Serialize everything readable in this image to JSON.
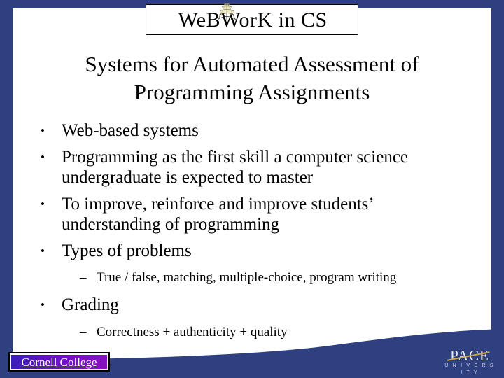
{
  "slide": {
    "header_logo": {
      "text": "WeBWorK in CS",
      "icon": "spider-web-icon"
    },
    "title": "Systems for Automated Assessment of Programming Assignments",
    "title_line1": "Systems for Automated Assessment of",
    "title_line2": "Programming Assignments",
    "bullets": [
      {
        "level": 1,
        "marker": "•",
        "text": "Web-based systems"
      },
      {
        "level": 1,
        "marker": "•",
        "text": "Programming as the first skill a computer science undergraduate is expected to master"
      },
      {
        "level": 1,
        "marker": "•",
        "text": "To improve, reinforce and improve students’ understanding of programming"
      },
      {
        "level": 1,
        "marker": "•",
        "text": "Types of problems"
      },
      {
        "level": 2,
        "marker": "–",
        "text": "True / false, matching, multiple-choice, program writing"
      },
      {
        "level": 1,
        "marker": "•",
        "text": "Grading"
      },
      {
        "level": 2,
        "marker": "–",
        "text": "Correctness + authenticity + quality"
      }
    ],
    "footer": {
      "cornell_label": "Cornell College",
      "pace_name": "PACE",
      "pace_sub": "U N I V E R S I T Y"
    },
    "colors": {
      "frame_navy": "#2e4080",
      "cornell_purple": "#6a12c8",
      "pace_gold": "#c8a44a",
      "text_black": "#000000",
      "background": "#ffffff"
    }
  }
}
